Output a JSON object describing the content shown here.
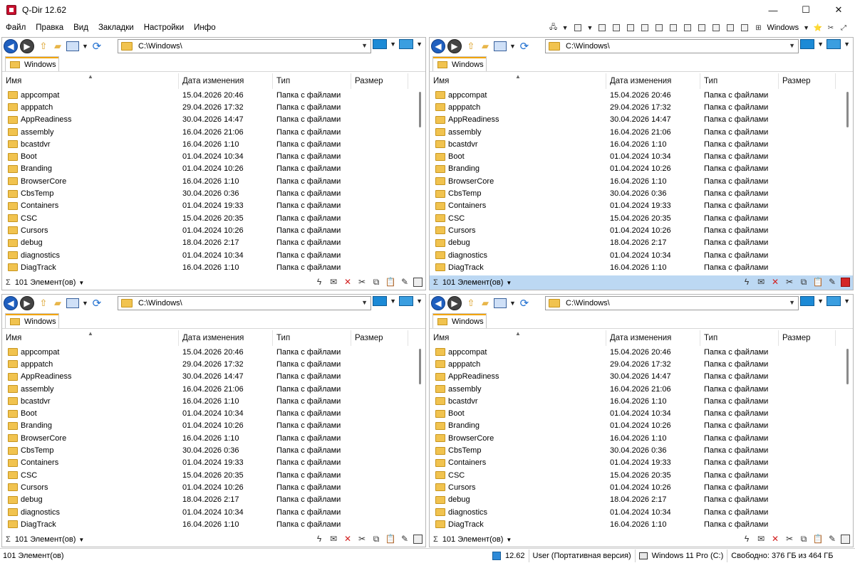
{
  "window": {
    "title": "Q-Dir 12.62"
  },
  "menu": {
    "items": [
      "Файл",
      "Правка",
      "Вид",
      "Закладки",
      "Настройки",
      "Инфо"
    ],
    "right_label": "Windows"
  },
  "panes": [
    {
      "id": "tl",
      "path": "C:\\Windows\\",
      "tab": "Windows",
      "active": false
    },
    {
      "id": "tr",
      "path": "C:\\Windows\\",
      "tab": "Windows",
      "active": true
    },
    {
      "id": "bl",
      "path": "C:\\Windows\\",
      "tab": "Windows",
      "active": false
    },
    {
      "id": "br",
      "path": "C:\\Windows\\",
      "tab": "Windows",
      "active": false
    }
  ],
  "columns": {
    "name": "Имя",
    "date": "Дата изменения",
    "type": "Тип",
    "size": "Размер"
  },
  "files": [
    {
      "name": "appcompat",
      "date": "15.04.2026 20:46",
      "type": "Папка с файлами"
    },
    {
      "name": "apppatch",
      "date": "29.04.2026 17:32",
      "type": "Папка с файлами"
    },
    {
      "name": "AppReadiness",
      "date": "30.04.2026 14:47",
      "type": "Папка с файлами"
    },
    {
      "name": "assembly",
      "date": "16.04.2026 21:06",
      "type": "Папка с файлами"
    },
    {
      "name": "bcastdvr",
      "date": "16.04.2026 1:10",
      "type": "Папка с файлами"
    },
    {
      "name": "Boot",
      "date": "01.04.2024 10:34",
      "type": "Папка с файлами"
    },
    {
      "name": "Branding",
      "date": "01.04.2024 10:26",
      "type": "Папка с файлами"
    },
    {
      "name": "BrowserCore",
      "date": "16.04.2026 1:10",
      "type": "Папка с файлами"
    },
    {
      "name": "CbsTemp",
      "date": "30.04.2026 0:36",
      "type": "Папка с файлами"
    },
    {
      "name": "Containers",
      "date": "01.04.2024 19:33",
      "type": "Папка с файлами"
    },
    {
      "name": "CSC",
      "date": "15.04.2026 20:35",
      "type": "Папка с файлами"
    },
    {
      "name": "Cursors",
      "date": "01.04.2024 10:26",
      "type": "Папка с файлами"
    },
    {
      "name": "debug",
      "date": "18.04.2026 2:17",
      "type": "Папка с файлами"
    },
    {
      "name": "diagnostics",
      "date": "01.04.2024 10:34",
      "type": "Папка с файлами"
    },
    {
      "name": "DiagTrack",
      "date": "16.04.2026 1:10",
      "type": "Папка с файлами"
    }
  ],
  "pane_status": {
    "sigma": "Σ",
    "count": "101 Элемент(ов)"
  },
  "statusbar": {
    "left": "101 Элемент(ов)",
    "version": "12.62",
    "user": "User (Портативная версия)",
    "os": "Windows  11 Pro (C:)",
    "free": "Свободно: 376 ГБ из 464 ГБ"
  }
}
